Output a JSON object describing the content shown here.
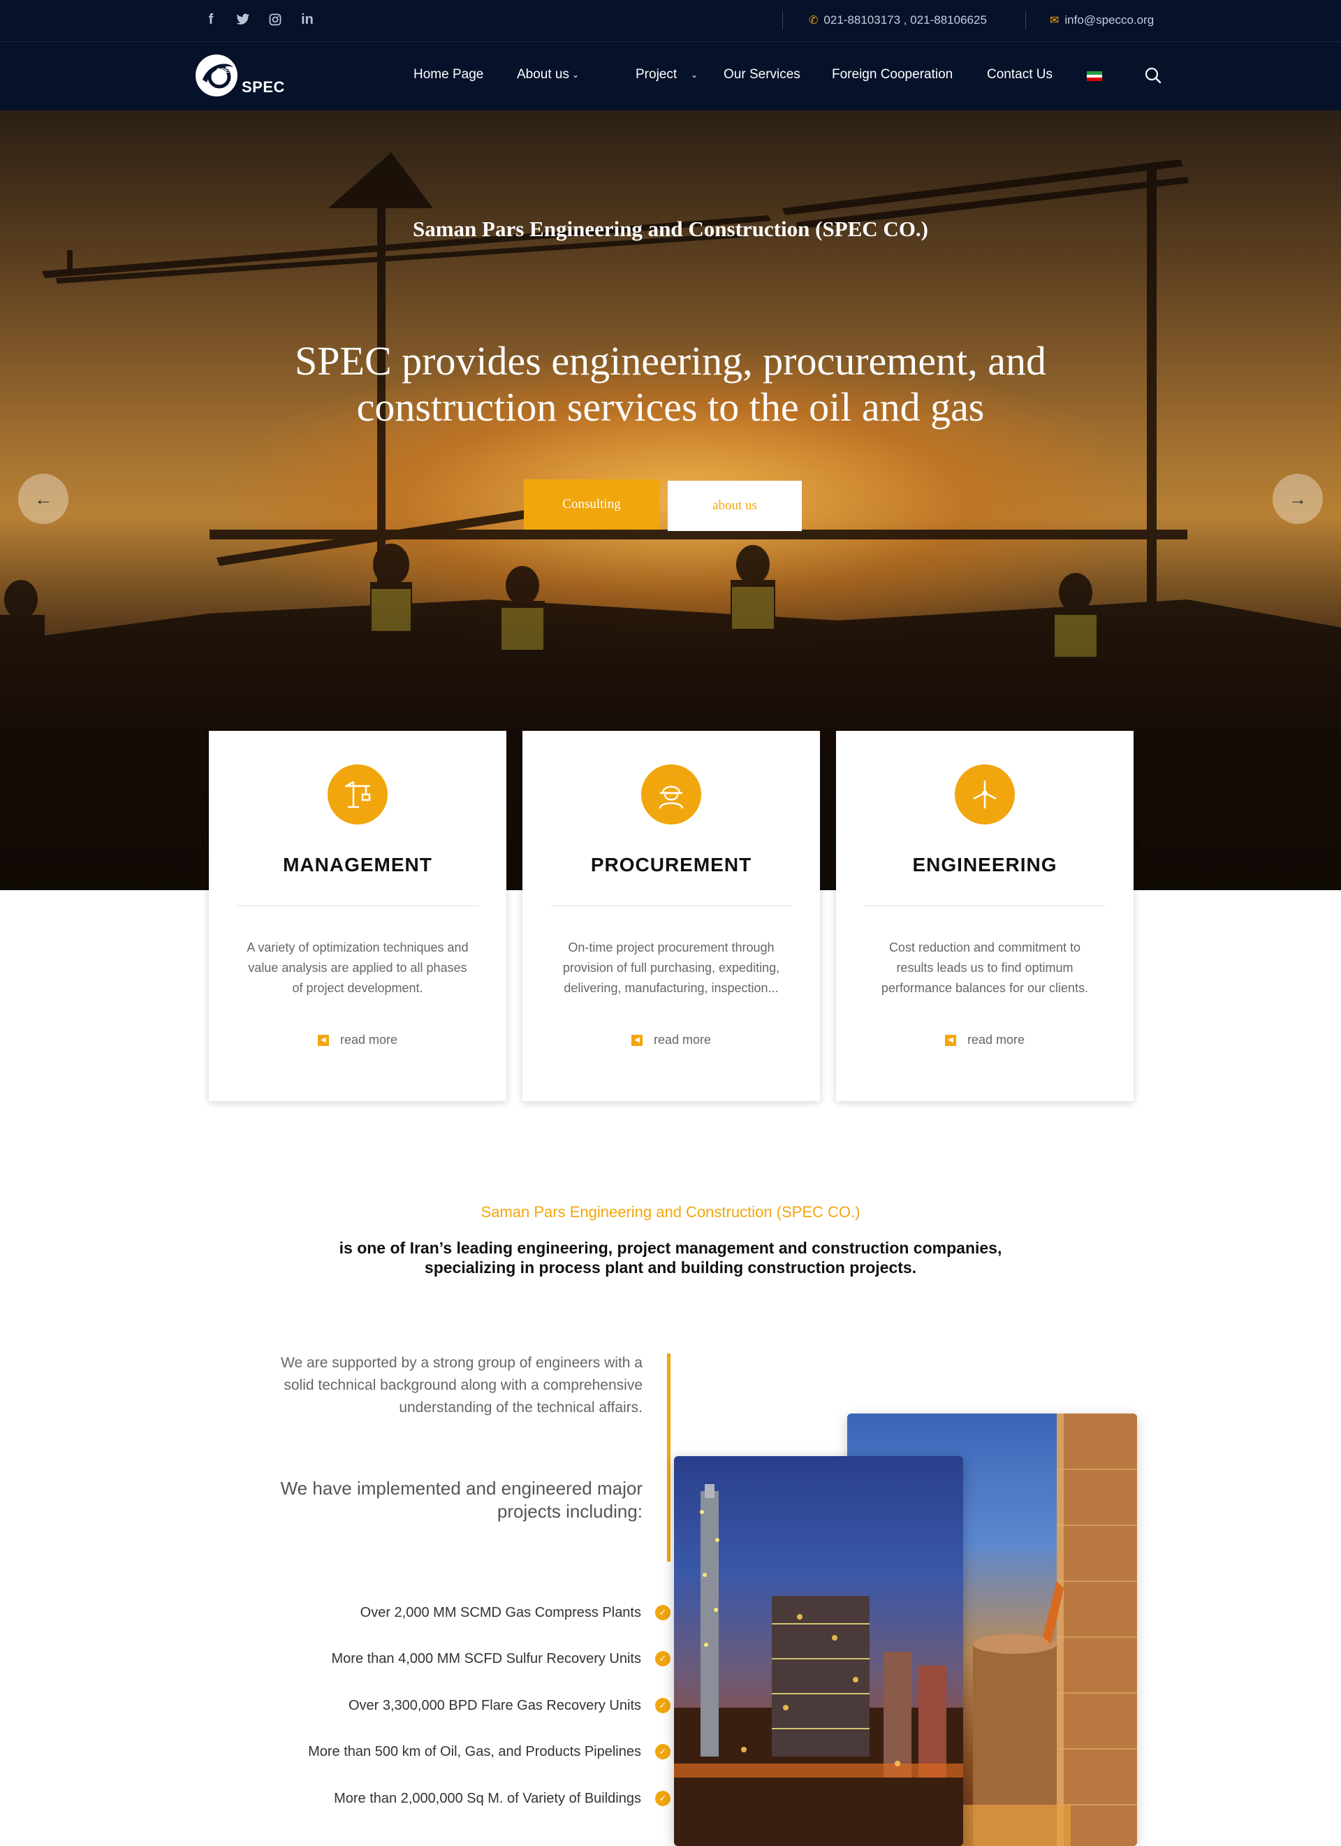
{
  "topbar": {
    "social": [
      "facebook-icon",
      "twitter-icon",
      "instagram-icon",
      "linkedin-icon"
    ],
    "phone": "021-88103173 , 021-88106625",
    "email": "info@specco.org"
  },
  "nav": {
    "logo_text": "SPEC",
    "logo_small": "SPEC",
    "items": [
      {
        "label": "Home Page"
      },
      {
        "label": "About us"
      },
      {
        "label": "Project"
      },
      {
        "label": "Our Services"
      },
      {
        "label": "Foreign Cooperation"
      },
      {
        "label": "Contact Us"
      }
    ]
  },
  "hero": {
    "kicker": "Saman Pars Engineering and Construction (SPEC CO.)",
    "title_line1": "SPEC provides engineering, procurement, and",
    "title_line2": "construction services to the oil and gas",
    "btn_primary": "Consulting",
    "btn_secondary": "about us"
  },
  "cards": [
    {
      "title": "MANAGEMENT",
      "text": "A variety of optimization techniques and value analysis are applied to all phases of project development.",
      "more": "read more",
      "icon": "crane-icon"
    },
    {
      "title": "PROCUREMENT",
      "text": "On-time project procurement through provision of full purchasing, expediting, delivering, manufacturing, inspection...",
      "more": "read more",
      "icon": "worker-icon"
    },
    {
      "title": "ENGINEERING",
      "text": "Cost reduction and commitment to results leads us to find optimum performance balances for our clients.",
      "more": "read more",
      "icon": "wind-turbine-icon"
    }
  ],
  "intro": {
    "kicker": "Saman Pars Engineering and Construction (SPEC CO.)",
    "line1": "is one of Iran’s leading engineering, project management and construction companies,",
    "line2": "specializing in process plant and building construction projects."
  },
  "about": {
    "support": "We are supported by a strong group of engineers with a solid technical background along with a comprehensive understanding of the technical affairs.",
    "implemented": "We have implemented and engineered major projects including:",
    "projects": [
      "Over 2,000 MM SCMD Gas Compress Plants",
      "More than 4,000 MM SCFD Sulfur Recovery Units",
      "Over 3,300,000 BPD Flare Gas Recovery Units",
      "More than 500 km of Oil, Gas, and Products Pipelines",
      "More than 2,000,000 Sq M. of Variety of Buildings"
    ]
  },
  "colors": {
    "accent": "#f2a60d",
    "navy": "#06112a"
  }
}
